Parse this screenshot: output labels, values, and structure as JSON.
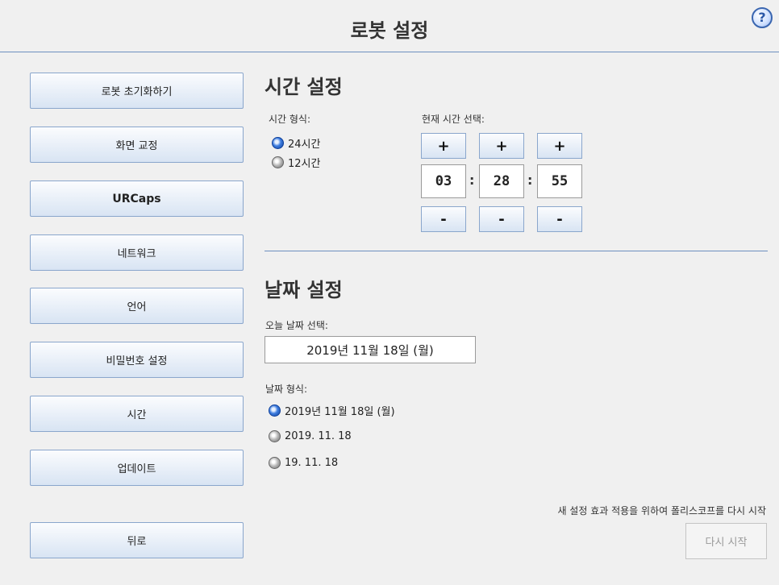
{
  "header": {
    "title": "로봇 설정",
    "help_icon": "?"
  },
  "nav": [
    {
      "label": "로봇 초기화하기"
    },
    {
      "label": "화면 교정"
    },
    {
      "label": "URCaps"
    },
    {
      "label": "네트워크"
    },
    {
      "label": "언어"
    },
    {
      "label": "비밀번호 설정"
    },
    {
      "label": "시간"
    },
    {
      "label": "업데이트"
    },
    {
      "label": "뒤로"
    }
  ],
  "time": {
    "section_title": "시간 설정",
    "format_label": "시간 형식:",
    "format_options": [
      "24시간",
      "12시간"
    ],
    "selected_format": "24시간",
    "current_label": "현재 시간 선택:",
    "plus": "+",
    "minus": "-",
    "separator": ":",
    "hour": "03",
    "minute": "28",
    "second": "55"
  },
  "date": {
    "section_title": "날짜 설정",
    "today_label": "오늘 날짜 선택:",
    "today_value": "2019년 11월 18일 (월)",
    "format_label": "날짜 형식:",
    "format_options": [
      "2019년 11월 18일 (월)",
      "2019. 11. 18",
      "19. 11. 18"
    ],
    "selected_format": "2019년 11월 18일 (월)"
  },
  "restart": {
    "note": "새 설정 효과 적용을 위하여 폴리스코프를 다시 시작",
    "button_label": "다시 시작",
    "enabled": false
  },
  "colors": {
    "accent": "#6d8fbf",
    "radio_on": "#3f7ee0"
  }
}
